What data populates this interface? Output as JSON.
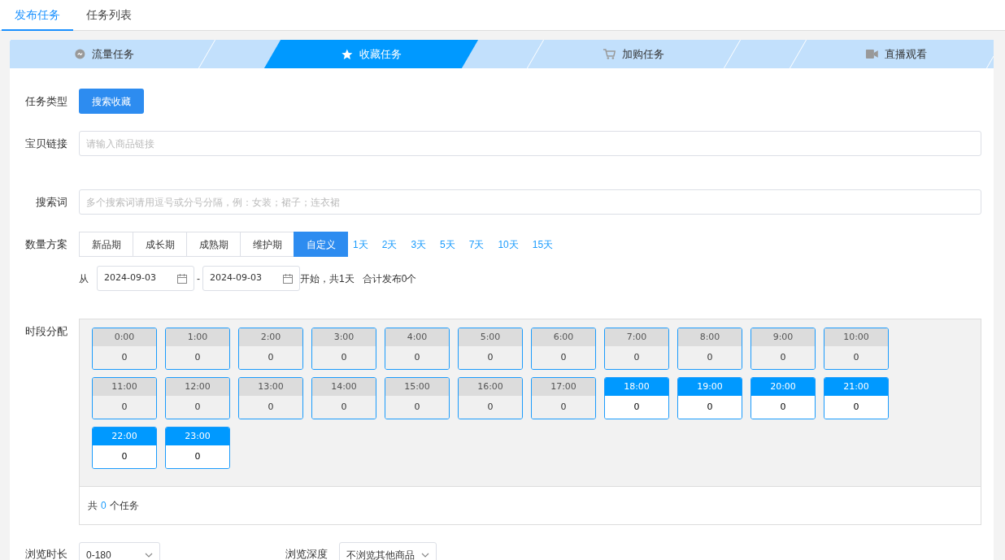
{
  "tabs": [
    {
      "label": "发布任务",
      "selected": true
    },
    {
      "label": "任务列表",
      "selected": false
    }
  ],
  "steps": [
    {
      "label": "流量任务",
      "selected": false
    },
    {
      "label": "收藏任务",
      "selected": true
    },
    {
      "label": "加购任务",
      "selected": false
    },
    {
      "label": "直播观看",
      "selected": false
    }
  ],
  "task_type": {
    "label": "任务类型",
    "button": "搜索收藏"
  },
  "item_link": {
    "label": "宝贝链接",
    "placeholder": "请输入商品链接"
  },
  "keywords": {
    "label": "搜索词",
    "placeholder": "多个搜索词请用逗号或分号分隔，例：女装；裙子；连衣裙"
  },
  "quantity": {
    "label": "数量方案",
    "presets": [
      {
        "label": "新品期",
        "selected": false
      },
      {
        "label": "成长期",
        "selected": false
      },
      {
        "label": "成熟期",
        "selected": false
      },
      {
        "label": "维护期",
        "selected": false
      },
      {
        "label": "自定义",
        "selected": true
      }
    ],
    "days": [
      "1天",
      "2天",
      "3天",
      "5天",
      "7天",
      "10天",
      "15天"
    ],
    "from_label": "从",
    "start_date": "2024-09-03",
    "separator": "-",
    "end_date": "2024-09-03",
    "summary": "开始，共1天",
    "total": "合计发布0个"
  },
  "time_slots": {
    "label": "时段分配",
    "slots": [
      {
        "time": "0:00",
        "count": "0",
        "selected": false
      },
      {
        "time": "1:00",
        "count": "0",
        "selected": false
      },
      {
        "time": "2:00",
        "count": "0",
        "selected": false
      },
      {
        "time": "3:00",
        "count": "0",
        "selected": false
      },
      {
        "time": "4:00",
        "count": "0",
        "selected": false
      },
      {
        "time": "5:00",
        "count": "0",
        "selected": false
      },
      {
        "time": "6:00",
        "count": "0",
        "selected": false
      },
      {
        "time": "7:00",
        "count": "0",
        "selected": false
      },
      {
        "time": "8:00",
        "count": "0",
        "selected": false
      },
      {
        "time": "9:00",
        "count": "0",
        "selected": false
      },
      {
        "time": "10:00",
        "count": "0",
        "selected": false
      },
      {
        "time": "11:00",
        "count": "0",
        "selected": false
      },
      {
        "time": "12:00",
        "count": "0",
        "selected": false
      },
      {
        "time": "13:00",
        "count": "0",
        "selected": false
      },
      {
        "time": "14:00",
        "count": "0",
        "selected": false
      },
      {
        "time": "15:00",
        "count": "0",
        "selected": false
      },
      {
        "time": "16:00",
        "count": "0",
        "selected": false
      },
      {
        "time": "17:00",
        "count": "0",
        "selected": false
      },
      {
        "time": "18:00",
        "count": "0",
        "selected": true
      },
      {
        "time": "19:00",
        "count": "0",
        "selected": true
      },
      {
        "time": "20:00",
        "count": "0",
        "selected": true
      },
      {
        "time": "21:00",
        "count": "0",
        "selected": true
      },
      {
        "time": "22:00",
        "count": "0",
        "selected": true
      },
      {
        "time": "23:00",
        "count": "0",
        "selected": true
      }
    ],
    "total_prefix": "共",
    "total_count": "0",
    "total_suffix": "个任务"
  },
  "browse": [
    {
      "label": "浏览时长",
      "value": "0-180"
    },
    {
      "label": "浏览深度",
      "value": "不浏览其他商品"
    }
  ]
}
